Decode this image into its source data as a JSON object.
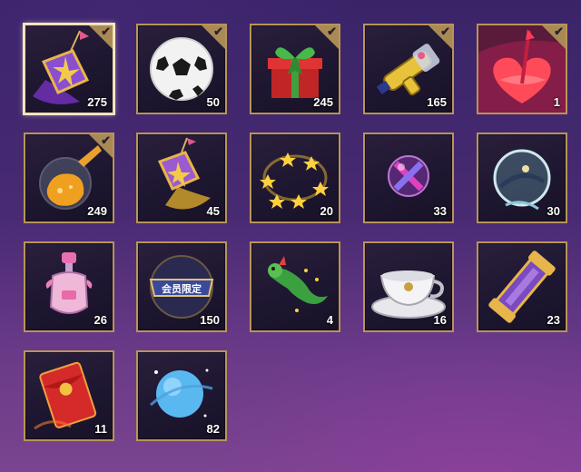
{
  "inventory": {
    "items": [
      {
        "icon": "pillow-with-flag-icon",
        "count": "275",
        "checked": true,
        "selected": true
      },
      {
        "icon": "soccer-ball-icon",
        "count": "50",
        "checked": true,
        "selected": false
      },
      {
        "icon": "gift-box-icon",
        "count": "245",
        "checked": true,
        "selected": false
      },
      {
        "icon": "water-gun-icon",
        "count": "165",
        "checked": true,
        "selected": false
      },
      {
        "icon": "pierced-heart-icon",
        "count": "1",
        "checked": true,
        "selected": false
      },
      {
        "icon": "potion-orb-icon",
        "count": "249",
        "checked": true,
        "selected": false
      },
      {
        "icon": "flag-pillow-icon",
        "count": "45",
        "checked": false,
        "selected": false
      },
      {
        "icon": "star-ring-icon",
        "count": "20",
        "checked": false,
        "selected": false
      },
      {
        "icon": "bubble-cross-icon",
        "count": "33",
        "checked": false,
        "selected": false
      },
      {
        "icon": "crystal-orb-icon",
        "count": "30",
        "checked": false,
        "selected": false
      },
      {
        "icon": "perfume-bottle-icon",
        "count": "26",
        "checked": false,
        "selected": false
      },
      {
        "icon": "member-badge-icon",
        "count": "150",
        "checked": false,
        "selected": false,
        "badge_text": "会员限定"
      },
      {
        "icon": "green-dragon-icon",
        "count": "4",
        "checked": false,
        "selected": false
      },
      {
        "icon": "teacup-icon",
        "count": "16",
        "checked": false,
        "selected": false
      },
      {
        "icon": "scroll-tube-icon",
        "count": "23",
        "checked": false,
        "selected": false
      },
      {
        "icon": "red-envelope-icon",
        "count": "11",
        "checked": false,
        "selected": false
      },
      {
        "icon": "blue-planet-icon",
        "count": "82",
        "checked": false,
        "selected": false
      }
    ],
    "check_glyph": "✔"
  }
}
